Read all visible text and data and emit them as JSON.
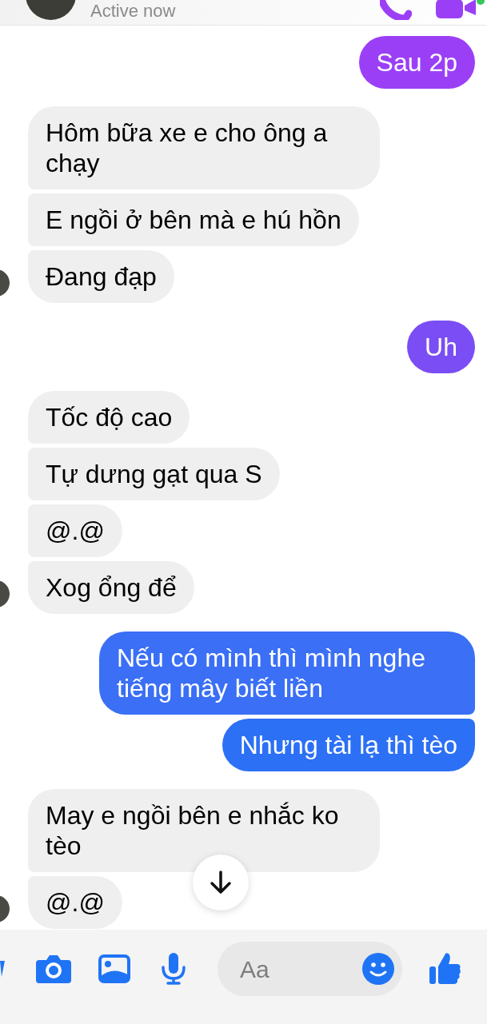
{
  "header": {
    "status": "Active now"
  },
  "groups": [
    {
      "kind": "outgoing",
      "messages": [
        {
          "text": "Sau 2p",
          "color": "#9b3ff7"
        }
      ]
    },
    {
      "kind": "incoming",
      "messages": [
        {
          "text": "Hôm bữa xe e cho ông a chạy"
        },
        {
          "text": "E ngồi ở bên mà e hú hồn"
        },
        {
          "text": "Đang đạp"
        }
      ]
    },
    {
      "kind": "outgoing",
      "messages": [
        {
          "text": "Uh",
          "color": "#7b4df4"
        }
      ]
    },
    {
      "kind": "incoming",
      "messages": [
        {
          "text": "Tốc độ cao"
        },
        {
          "text": "Tự dưng gạt qua S"
        },
        {
          "text": "@.@"
        },
        {
          "text": "Xog ổng để"
        }
      ]
    },
    {
      "kind": "outgoing",
      "messages": [
        {
          "text": "Nếu có mình thì mình nghe tiếng mây biết liền",
          "color": "#3a6ff6"
        },
        {
          "text": "Nhưng tài lạ thì tèo",
          "color": "#2c70f5"
        }
      ]
    },
    {
      "kind": "incoming",
      "messages": [
        {
          "text": "May e ngồi bên e nhắc ko tèo"
        },
        {
          "text": "@.@"
        }
      ]
    }
  ],
  "composer": {
    "placeholder": "Aa"
  }
}
